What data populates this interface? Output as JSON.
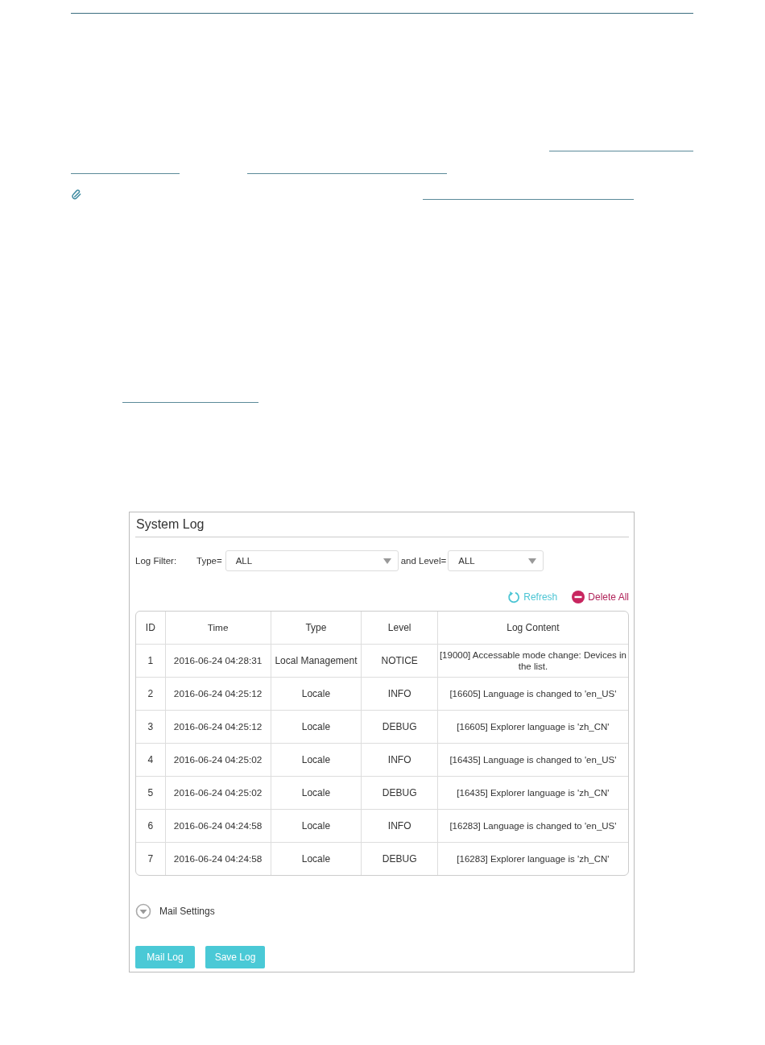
{
  "system_log": {
    "title": "System Log",
    "filter": {
      "label": "Log Filter:",
      "type_label": "Type=",
      "type_value": "ALL",
      "level_label": "and Level=",
      "level_value": "ALL"
    },
    "actions": [
      "Refresh",
      "Delete All"
    ],
    "table": {
      "columns": [
        "ID",
        "Time",
        "Type",
        "Level",
        "Log Content"
      ],
      "rows": [
        [
          "1",
          "2016-06-24 04:28:31",
          "Local Management",
          "NOTICE",
          "[19000] Accessable mode change: Devices in the list."
        ],
        [
          "2",
          "2016-06-24 04:25:12",
          "Locale",
          "INFO",
          "[16605] Language is changed to 'en_US'"
        ],
        [
          "3",
          "2016-06-24 04:25:12",
          "Locale",
          "DEBUG",
          "[16605] Explorer language is 'zh_CN'"
        ],
        [
          "4",
          "2016-06-24 04:25:02",
          "Locale",
          "INFO",
          "[16435] Language is changed to 'en_US'"
        ],
        [
          "5",
          "2016-06-24 04:25:02",
          "Locale",
          "DEBUG",
          "[16435] Explorer language is 'zh_CN'"
        ],
        [
          "6",
          "2016-06-24 04:24:58",
          "Locale",
          "INFO",
          "[16283] Language is changed to 'en_US'"
        ],
        [
          "7",
          "2016-06-24 04:24:58",
          "Locale",
          "DEBUG",
          "[16283] Explorer language is 'zh_CN'"
        ]
      ]
    },
    "mail_settings": {
      "label": "Mail Settings",
      "expanded": false
    },
    "buttons": [
      "Mail Log",
      "Save Log"
    ]
  }
}
